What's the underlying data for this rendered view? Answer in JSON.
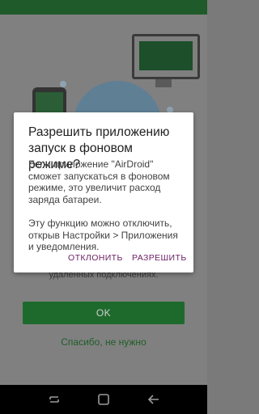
{
  "background": {
    "description_text": "удаленных подключениях.",
    "ok_label": "OK",
    "skip_label": "Спасибо, не нужно"
  },
  "dialog": {
    "title": "Разрешить приложению запуск в фоновом режиме?",
    "body": "Если приложение \"AirDroid\" сможет запускаться в фоновом режиме, это увеличит расход заряда батареи.\n\nЭту функцию можно отключить, открыв Настройки > Приложения и уведомления.",
    "decline_label": "ОТКЛОНИТЬ",
    "allow_label": "РАЗРЕШИТЬ"
  },
  "nav": {
    "icons": [
      "recent-apps-icon",
      "home-icon",
      "back-icon"
    ]
  },
  "colors": {
    "accent_green": "#1e6a2d",
    "dialog_button": "#6b1e64"
  }
}
